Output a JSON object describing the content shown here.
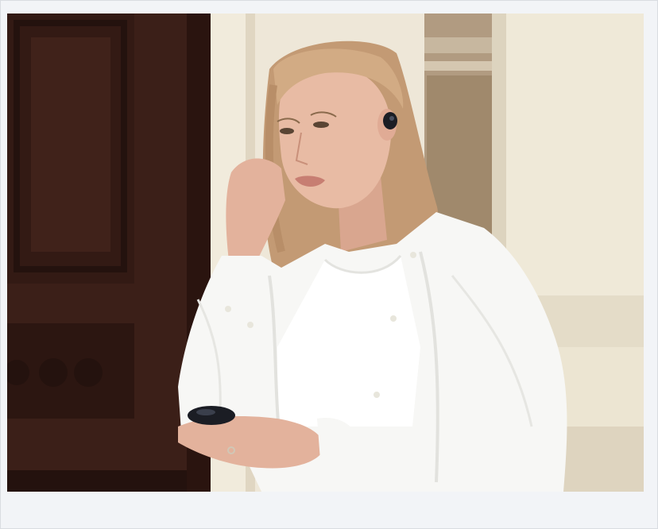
{
  "image": {
    "subject": "woman-with-wireless-earbuds",
    "palette": {
      "door": "#3b1f18",
      "door_shadow": "#24120e",
      "wall": "#e8e0cf",
      "stone": "#a28c72",
      "column": "#f1ebd9",
      "skin": "#e6b7a1",
      "hair": "#caa07b",
      "shirt": "#f7f7f5",
      "tee": "#ffffff",
      "earbud": "#1b1d24",
      "frame_bg": "#f2f4f7"
    }
  }
}
